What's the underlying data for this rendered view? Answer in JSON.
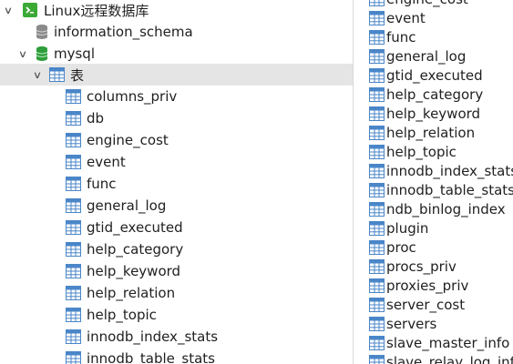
{
  "tree": {
    "connection": {
      "label": "Linux远程数据库",
      "icon": "linux-connection-icon"
    },
    "databases": [
      {
        "label": "information_schema",
        "icon": "database-icon-gray"
      },
      {
        "label": "mysql",
        "icon": "database-icon-green",
        "expanded": true
      }
    ],
    "tables_folder": {
      "label": "表",
      "icon": "table-folder-icon"
    },
    "tables": [
      "columns_priv",
      "db",
      "engine_cost",
      "event",
      "func",
      "general_log",
      "gtid_executed",
      "help_category",
      "help_keyword",
      "help_relation",
      "help_topic",
      "innodb_index_stats",
      "innodb_table_stats"
    ]
  },
  "objects": {
    "items": [
      "engine_cost",
      "event",
      "func",
      "general_log",
      "gtid_executed",
      "help_category",
      "help_keyword",
      "help_relation",
      "help_topic",
      "innodb_index_stats",
      "innodb_table_stats",
      "ndb_binlog_index",
      "plugin",
      "proc",
      "procs_priv",
      "proxies_priv",
      "server_cost",
      "servers",
      "slave_master_info",
      "slave_relay_log_info"
    ]
  },
  "colors": {
    "selection": "#e5e5e5",
    "table_icon": "#4a86c8",
    "db_green": "#2e9e3a",
    "db_gray": "#8a8a8a",
    "linux_green": "#3aaa35"
  }
}
